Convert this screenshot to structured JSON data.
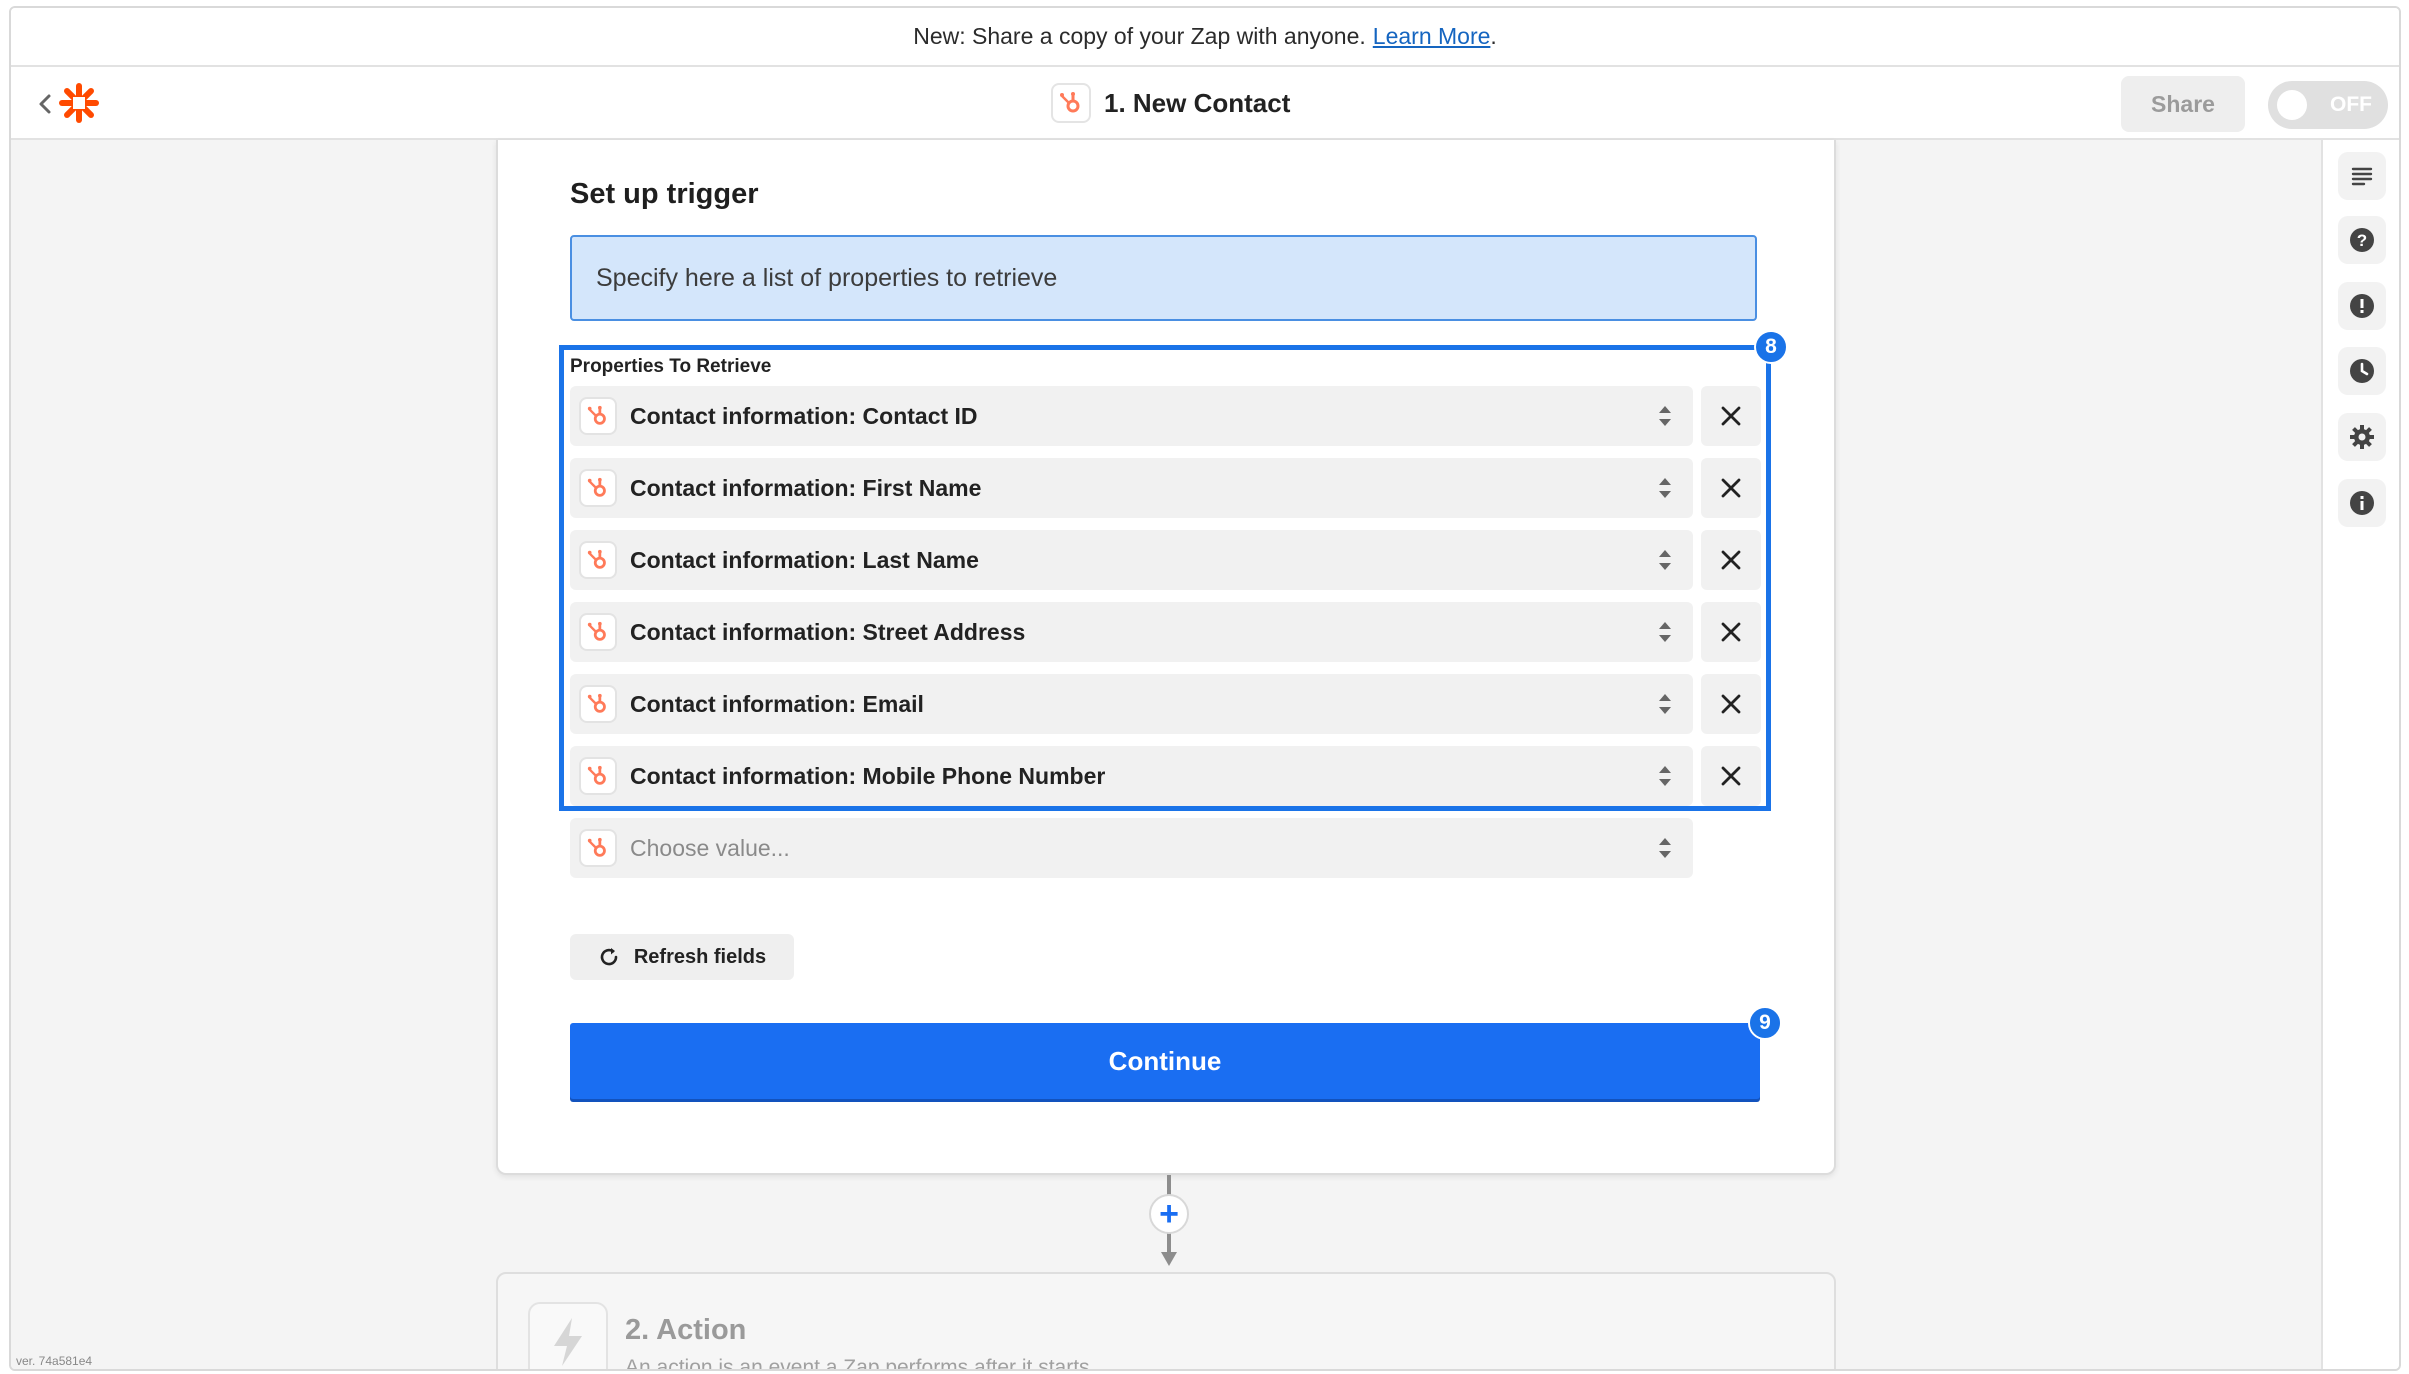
{
  "announcement": {
    "text": "New: Share a copy of your Zap with anyone.",
    "link": "Learn More",
    "suffix": "."
  },
  "header": {
    "title": "1. New Contact",
    "share_label": "Share",
    "toggle_label": "OFF"
  },
  "trigger": {
    "title": "Set up trigger",
    "info": "Specify here a list of properties to retrieve",
    "field_label": "Properties To Retrieve",
    "properties": [
      "Contact information: Contact ID",
      "Contact information: First Name",
      "Contact information: Last Name",
      "Contact information: Street Address",
      "Contact information: Email",
      "Contact information: Mobile Phone Number"
    ],
    "placeholder": "Choose value...",
    "refresh_label": "Refresh fields",
    "continue_label": "Continue",
    "badge_properties": "8",
    "badge_continue": "9"
  },
  "action": {
    "title": "2. Action",
    "subtitle": "An action is an event a Zap performs after it starts"
  },
  "version": "ver. 74a581e4",
  "icons": {
    "back": "chevron-left-icon",
    "logo": "zapier-logo-icon",
    "app": "hubspot-icon",
    "rail": [
      "notes-icon",
      "help-icon",
      "alert-icon",
      "history-icon",
      "settings-icon",
      "info-icon"
    ]
  },
  "colors": {
    "accent": "#1a6ef2",
    "hubspot": "#ff7a59",
    "zapier": "#ff4a00",
    "info_bg": "#d4e6fb"
  }
}
